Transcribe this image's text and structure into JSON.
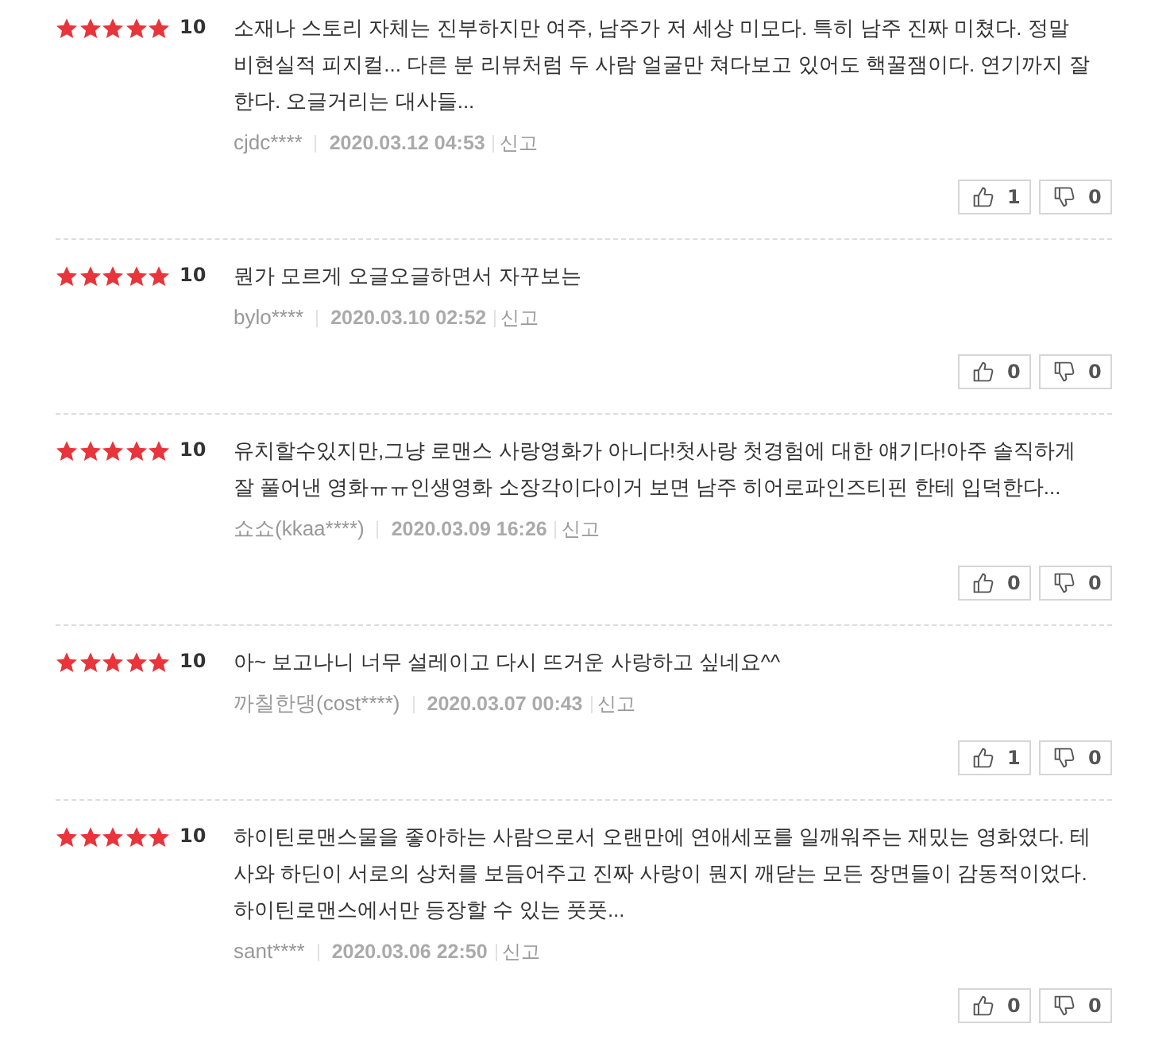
{
  "reviews": [
    {
      "stars": 5,
      "score": "10",
      "text": "소재나 스토리 자체는 진부하지만 여주, 남주가 저 세상 미모다. 특히 남주 진짜 미쳤다. 정말 비현실적 피지컬... 다른 분 리뷰처럼 두 사람 얼굴만 쳐다보고 있어도 핵꿀잼이다. 연기까지 잘 한다. 오글거리는 대사들...",
      "author": "cjdc****",
      "date": "2020.03.12 04:53",
      "report": "신고",
      "likes": "1",
      "dislikes": "0"
    },
    {
      "stars": 5,
      "score": "10",
      "text": "뭔가 모르게 오글오글하면서 자꾸보는",
      "author": "bylo****",
      "date": "2020.03.10 02:52",
      "report": "신고",
      "likes": "0",
      "dislikes": "0"
    },
    {
      "stars": 5,
      "score": "10",
      "text": "유치할수있지만,그냥 로맨스 사랑영화가 아니다!첫사랑 첫경험에 대한 얘기다!아주 솔직하게 잘 풀어낸 영화ㅠㅠ인생영화 소장각이다이거 보면 남주 히어로파인즈티핀 한테 입덕한다...",
      "author": "쇼쇼(kkaa****)",
      "date": "2020.03.09 16:26",
      "report": "신고",
      "likes": "0",
      "dislikes": "0"
    },
    {
      "stars": 5,
      "score": "10",
      "text": "아~ 보고나니 너무 설레이고 다시 뜨거운 사랑하고 싶네요^^",
      "author": "까칠한댕(cost****)",
      "date": "2020.03.07 00:43",
      "report": "신고",
      "likes": "1",
      "dislikes": "0"
    },
    {
      "stars": 5,
      "score": "10",
      "text": "하이틴로맨스물을 좋아하는 사람으로서 오랜만에 연애세포를 일깨워주는 재밌는 영화였다. 테사와 하딘이 서로의 상처를 보듬어주고 진짜 사랑이 뭔지 깨닫는 모든 장면들이 감동적이었다. 하이틴로맨스에서만 등장할 수 있는 풋풋...",
      "author": "sant****",
      "date": "2020.03.06 22:50",
      "report": "신고",
      "likes": "0",
      "dislikes": "0"
    }
  ]
}
